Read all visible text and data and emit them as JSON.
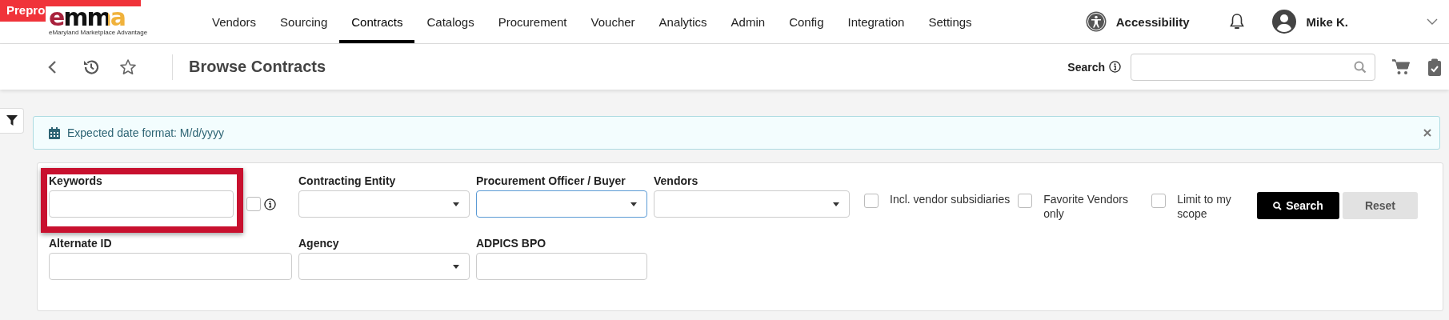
{
  "environment_badge": "Prepro",
  "logo": {
    "text": "emma",
    "tagline": "eMaryland Marketplace Advantage"
  },
  "nav": [
    {
      "label": "Vendors",
      "selected": false
    },
    {
      "label": "Sourcing",
      "selected": false
    },
    {
      "label": "Contracts",
      "selected": true
    },
    {
      "label": "Catalogs",
      "selected": false
    },
    {
      "label": "Procurement",
      "selected": false
    },
    {
      "label": "Voucher",
      "selected": false
    },
    {
      "label": "Analytics",
      "selected": false
    },
    {
      "label": "Admin",
      "selected": false
    },
    {
      "label": "Config",
      "selected": false
    },
    {
      "label": "Integration",
      "selected": false
    },
    {
      "label": "Settings",
      "selected": false
    }
  ],
  "accessibility": "Accessibility",
  "user": "Mike K.",
  "toolbar": {
    "title": "Browse Contracts",
    "search_label": "Search"
  },
  "alert": "Expected date format: M/d/yyyy",
  "form": {
    "rows": [
      [
        {
          "label": "Keywords",
          "kind": "text",
          "focused": false,
          "highlighted": true,
          "exact_checkbox": {
            "checked": false
          }
        },
        {
          "label": "Contracting Entity",
          "kind": "select",
          "focused": false,
          "highlighted": false
        },
        {
          "label": "Procurement Officer / Buyer",
          "kind": "select",
          "focused": true,
          "highlighted": false
        },
        {
          "label": "Vendors",
          "kind": "select",
          "focused": false,
          "highlighted": false
        }
      ],
      [
        {
          "label": "Alternate ID",
          "kind": "text",
          "focused": false,
          "highlighted": false
        },
        {
          "label": "Agency",
          "kind": "select",
          "focused": false,
          "highlighted": false
        },
        {
          "label": "ADPICS BPO",
          "kind": "text",
          "focused": false,
          "highlighted": false
        }
      ]
    ],
    "options": [
      {
        "label": "Incl. vendor subsidiaries",
        "checked": false
      },
      {
        "label": "Favorite Vendors only",
        "checked": false
      },
      {
        "label": "Limit to my scope",
        "checked": false
      }
    ],
    "buttons": [
      {
        "label": "Search",
        "kind": "primary"
      },
      {
        "label": "Reset",
        "kind": "secondary"
      }
    ]
  }
}
